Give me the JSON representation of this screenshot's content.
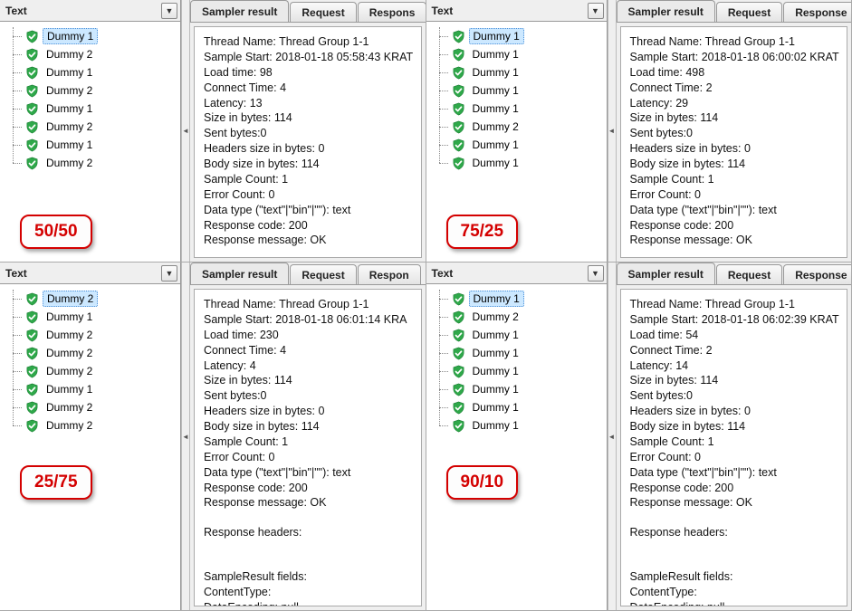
{
  "common": {
    "left_header": "Text",
    "tabs": {
      "sampler": "Sampler result",
      "request": "Request",
      "response": "Response",
      "response_clipped": "Respons",
      "response_clipped2": "Respon",
      "response_clipped3": "Response "
    }
  },
  "quadrants": [
    {
      "badge": "50/50",
      "tree": [
        {
          "label": "Dummy 1",
          "selected": true
        },
        {
          "label": "Dummy 2"
        },
        {
          "label": "Dummy 1"
        },
        {
          "label": "Dummy 2"
        },
        {
          "label": "Dummy 1"
        },
        {
          "label": "Dummy 2"
        },
        {
          "label": "Dummy 1"
        },
        {
          "label": "Dummy 2"
        }
      ],
      "result": {
        "thread_name": "Thread Group 1-1",
        "sample_start": "2018-01-18 05:58:43 KRAT",
        "load_time": "98",
        "connect_time": "4",
        "latency": "13",
        "size_bytes": "114",
        "sent_bytes": "0",
        "headers_size": "0",
        "body_size": "114",
        "sample_count": "1",
        "error_count": "0",
        "data_type": "(\"text\"|\"bin\"|\"\"): text",
        "response_code": "200",
        "response_message": "OK"
      },
      "show_extra": false
    },
    {
      "badge": "75/25",
      "tree": [
        {
          "label": "Dummy 1",
          "selected": true
        },
        {
          "label": "Dummy 1"
        },
        {
          "label": "Dummy 1"
        },
        {
          "label": "Dummy 1"
        },
        {
          "label": "Dummy 1"
        },
        {
          "label": "Dummy 2"
        },
        {
          "label": "Dummy 1"
        },
        {
          "label": "Dummy 1"
        }
      ],
      "result": {
        "thread_name": "Thread Group 1-1",
        "sample_start": "2018-01-18 06:00:02 KRAT",
        "load_time": "498",
        "connect_time": "2",
        "latency": "29",
        "size_bytes": "114",
        "sent_bytes": "0",
        "headers_size": "0",
        "body_size": "114",
        "sample_count": "1",
        "error_count": "0",
        "data_type": "(\"text\"|\"bin\"|\"\"): text",
        "response_code": "200",
        "response_message": "OK"
      },
      "show_extra": false
    },
    {
      "badge": "25/75",
      "tree": [
        {
          "label": "Dummy 2",
          "selected": true
        },
        {
          "label": "Dummy 1"
        },
        {
          "label": "Dummy 2"
        },
        {
          "label": "Dummy 2"
        },
        {
          "label": "Dummy 2"
        },
        {
          "label": "Dummy 1"
        },
        {
          "label": "Dummy 2"
        },
        {
          "label": "Dummy 2"
        }
      ],
      "result": {
        "thread_name": "Thread Group 1-1",
        "sample_start": "2018-01-18 06:01:14 KRA",
        "load_time": "230",
        "connect_time": "4",
        "latency": "4",
        "size_bytes": "114",
        "sent_bytes": "0",
        "headers_size": "0",
        "body_size": "114",
        "sample_count": "1",
        "error_count": "0",
        "data_type": "(\"text\"|\"bin\"|\"\"): text",
        "response_code": "200",
        "response_message": "OK"
      },
      "show_extra": true,
      "extra": {
        "response_headers": "Response headers:",
        "sampleresult_fields": "SampleResult fields:",
        "content_type": "ContentType:",
        "data_encoding": "DataEncoding: null"
      }
    },
    {
      "badge": "90/10",
      "tree": [
        {
          "label": "Dummy 1",
          "selected": true
        },
        {
          "label": "Dummy 2"
        },
        {
          "label": "Dummy 1"
        },
        {
          "label": "Dummy 1"
        },
        {
          "label": "Dummy 1"
        },
        {
          "label": "Dummy 1"
        },
        {
          "label": "Dummy 1"
        },
        {
          "label": "Dummy 1"
        }
      ],
      "result": {
        "thread_name": "Thread Group 1-1",
        "sample_start": "2018-01-18 06:02:39 KRAT",
        "load_time": "54",
        "connect_time": "2",
        "latency": "14",
        "size_bytes": "114",
        "sent_bytes": "0",
        "headers_size": "0",
        "body_size": "114",
        "sample_count": "1",
        "error_count": "0",
        "data_type": "(\"text\"|\"bin\"|\"\"): text",
        "response_code": "200",
        "response_message": "OK"
      },
      "show_extra": true,
      "extra": {
        "response_headers": "Response headers:",
        "sampleresult_fields": "SampleResult fields:",
        "content_type": "ContentType:",
        "data_encoding": "DataEncoding: null"
      }
    }
  ],
  "labels": {
    "thread_name": "Thread Name: ",
    "sample_start": "Sample Start: ",
    "load_time": "Load time: ",
    "connect_time": "Connect Time: ",
    "latency": "Latency: ",
    "size_bytes": "Size in bytes: ",
    "sent_bytes": "Sent bytes:",
    "headers_size": "Headers size in bytes: ",
    "body_size": "Body size in bytes: ",
    "sample_count": "Sample Count: ",
    "error_count": "Error Count: ",
    "data_type": "Data type ",
    "response_code": "Response code: ",
    "response_message": "Response message: "
  }
}
